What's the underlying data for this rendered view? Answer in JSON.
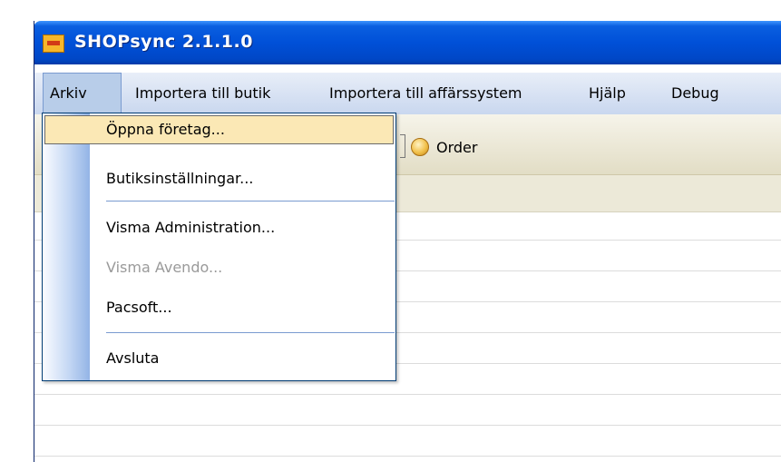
{
  "window": {
    "title": "SHOPsync 2.1.1.0",
    "icon": "shop-app-icon"
  },
  "menubar": {
    "items": [
      {
        "label": "Arkiv",
        "active": true
      },
      {
        "label": "Importera till butik"
      },
      {
        "label": "Importera till affärssystem"
      },
      {
        "label": "Hjälp"
      },
      {
        "label": "Debug"
      }
    ]
  },
  "toolbar": {
    "order_label": "Order",
    "order_icon": "package-icon"
  },
  "dropdown": {
    "items": [
      {
        "label": "Öppna företag...",
        "hover": true
      },
      {
        "label": "Butiksinställningar..."
      },
      {
        "separator": true
      },
      {
        "label": "Visma Administration..."
      },
      {
        "label": "Visma Avendo...",
        "disabled": true
      },
      {
        "label": "Pacsoft..."
      },
      {
        "separator": true
      },
      {
        "label": "Avsluta"
      }
    ]
  },
  "colors": {
    "title_bar": "#0050d8",
    "menu_hover": "#fbe8b5",
    "disabled_text": "#9a9a9a"
  }
}
